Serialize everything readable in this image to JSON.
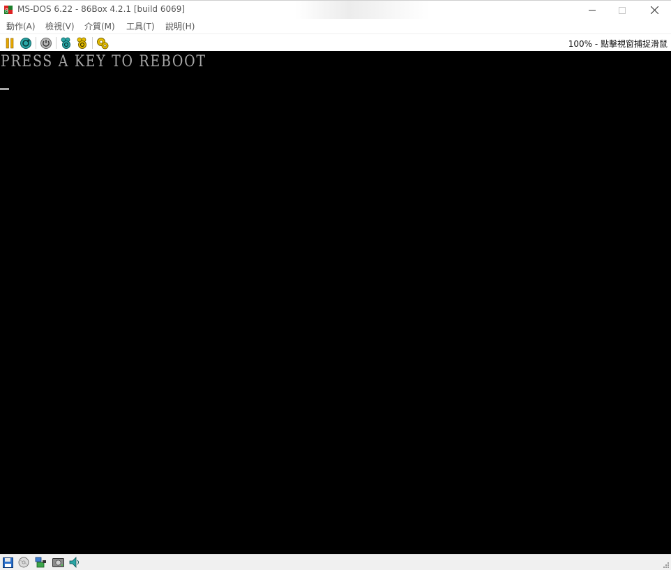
{
  "window": {
    "title": "MS-DOS 6.22 - 86Box 4.2.1 [build 6069]",
    "app_icon": "86box-logo-icon",
    "controls": {
      "minimize": "minimize-icon",
      "maximize": "maximize-icon",
      "close": "close-icon"
    }
  },
  "menubar": {
    "items": [
      {
        "label": "動作(A)"
      },
      {
        "label": "檢視(V)"
      },
      {
        "label": "介質(M)"
      },
      {
        "label": "工具(T)"
      },
      {
        "label": "說明(H)"
      }
    ]
  },
  "toolbar": {
    "buttons": [
      {
        "icon": "pause-icon"
      },
      {
        "icon": "hard-reset-icon"
      },
      {
        "icon": "acpi-shutdown-icon"
      },
      {
        "icon": "ctrl-alt-del-icon"
      },
      {
        "icon": "ctrl-alt-esc-icon"
      },
      {
        "icon": "settings-icon"
      }
    ],
    "zoom_status": "100% - 點擊視窗捕捉滑鼠"
  },
  "screen": {
    "lines": [
      "PRESS A KEY TO REBOOT"
    ],
    "cursor": "_",
    "text_color": "#a8a8a8",
    "background": "#000000"
  },
  "statusbar": {
    "icons": [
      {
        "icon": "floppy-disk-icon"
      },
      {
        "icon": "cdrom-icon"
      },
      {
        "icon": "network-icon"
      },
      {
        "icon": "hard-disk-icon"
      },
      {
        "icon": "sound-icon"
      }
    ]
  },
  "colors": {
    "toolbar_accent_yellow": "#e8a800",
    "toolbar_accent_teal": "#2aa7a7",
    "statusbar_bg": "#f0f0f0"
  }
}
